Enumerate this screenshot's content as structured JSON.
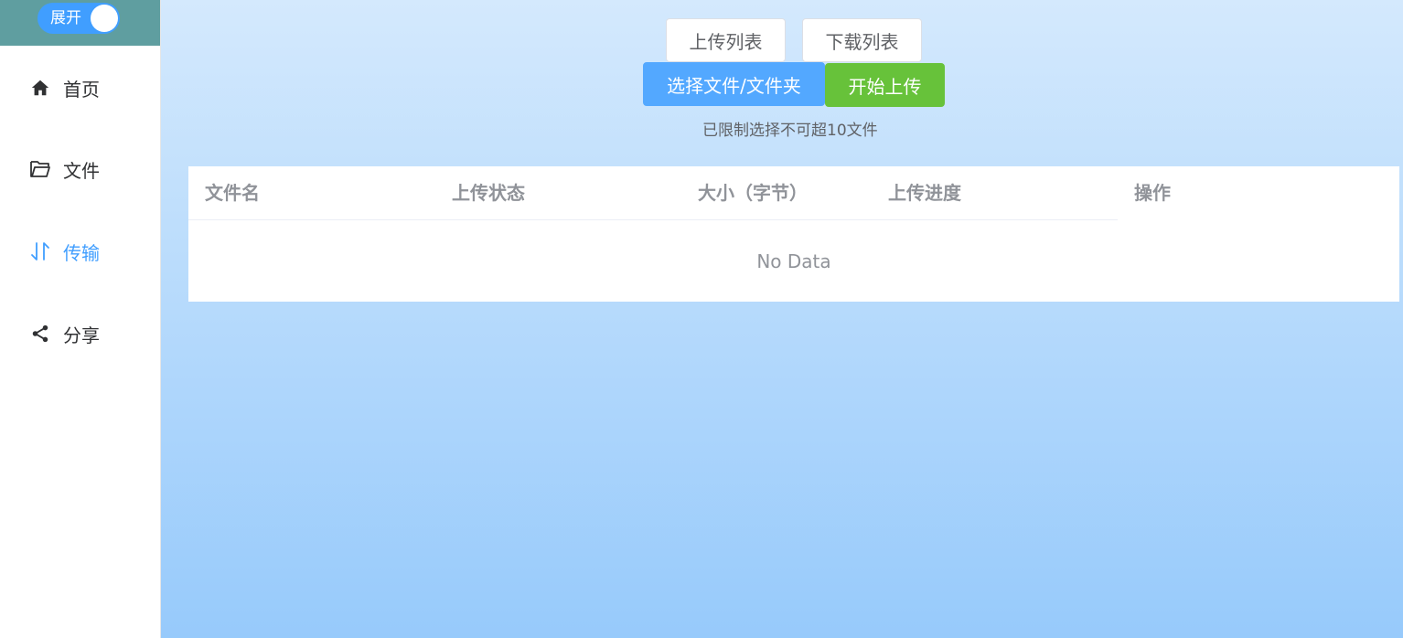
{
  "sidebar": {
    "toggle_label": "展开",
    "items": [
      {
        "label": "首页",
        "icon": "home-icon"
      },
      {
        "label": "文件",
        "icon": "folder-icon"
      },
      {
        "label": "传输",
        "icon": "transfer-icon",
        "active": true
      },
      {
        "label": "分享",
        "icon": "share-icon"
      }
    ]
  },
  "toolbar": {
    "upload_list": "上传列表",
    "download_list": "下载列表",
    "select_files": "选择文件/文件夹",
    "start_upload": "开始上传",
    "hint": "已限制选择不可超10文件"
  },
  "table": {
    "columns": [
      "文件名",
      "上传状态",
      "大小（字节）",
      "上传进度",
      "操作"
    ],
    "empty_text": "No Data"
  },
  "colors": {
    "primary": "#409eff",
    "success": "#67c23a",
    "sidebar_header": "#5f9ea0"
  }
}
